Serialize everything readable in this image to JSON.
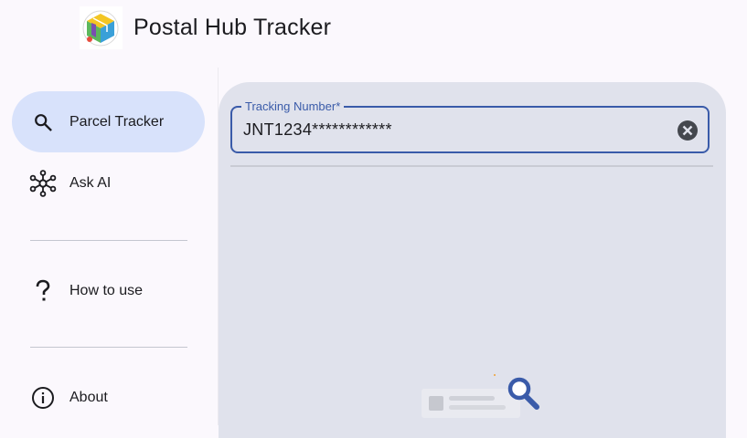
{
  "app": {
    "title": "Postal Hub Tracker",
    "logo_icon": "package-box-logo"
  },
  "sidebar": {
    "items": [
      {
        "label": "Parcel Tracker",
        "icon": "search-icon",
        "active": true
      },
      {
        "label": "Ask AI",
        "icon": "hub-network-icon",
        "active": false
      },
      {
        "label": "How to use",
        "icon": "question-mark-icon",
        "active": false
      },
      {
        "label": "About",
        "icon": "info-icon",
        "active": false
      }
    ]
  },
  "tracking": {
    "label": "Tracking Number*",
    "value": "JNT1234************",
    "clear_icon": "close-circle-icon"
  },
  "empty_state": {
    "icon": "search-illustration"
  },
  "colors": {
    "background": "#fbf8fd",
    "active_nav": "#d8e2fb",
    "panel": "#e0e2ec",
    "accent": "#3a5ba9",
    "text": "#1b1b1f"
  }
}
